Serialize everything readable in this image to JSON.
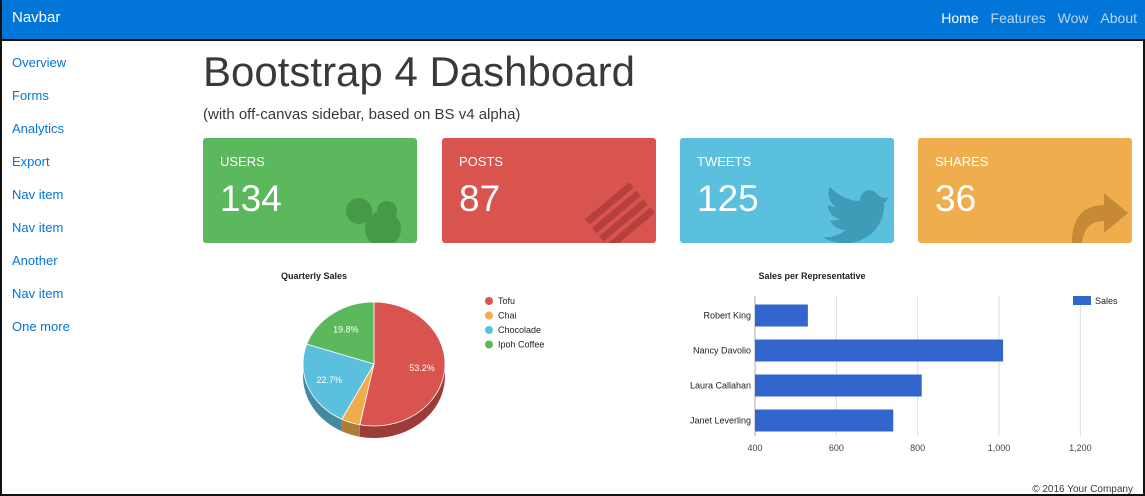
{
  "navbar": {
    "brand": "Navbar",
    "links": [
      "Home",
      "Features",
      "Wow",
      "About"
    ],
    "active": "Home",
    "color": "#0275d8"
  },
  "sidebar": {
    "items": [
      "Overview",
      "Forms",
      "Analytics",
      "Export",
      "Nav item",
      "Nav item",
      "Another",
      "Nav item",
      "One more"
    ]
  },
  "header": {
    "title": "Bootstrap 4 Dashboard",
    "subtitle": "(with off-canvas sidebar, based on BS v4 alpha)"
  },
  "cards": [
    {
      "label": "USERS",
      "value": "134",
      "color": "#5cb85c",
      "icon": "users-icon"
    },
    {
      "label": "POSTS",
      "value": "87",
      "color": "#d9534f",
      "icon": "list-icon"
    },
    {
      "label": "TWEETS",
      "value": "125",
      "color": "#5bc0de",
      "icon": "twitter-icon"
    },
    {
      "label": "SHARES",
      "value": "36",
      "color": "#f0ad4e",
      "icon": "share-icon"
    }
  ],
  "chart_data": [
    {
      "type": "pie",
      "title": "Quarterly Sales",
      "categories": [
        "Tofu",
        "Chai",
        "Chocolade",
        "Ipoh Coffee"
      ],
      "values": [
        53.2,
        4.3,
        22.7,
        19.8
      ],
      "value_labels": [
        "53.2%",
        "",
        "22.7%",
        "19.8%"
      ],
      "colors": [
        "#d9534f",
        "#f0ad4e",
        "#5bc0de",
        "#5cb85c"
      ],
      "legend": "right",
      "style": "3d"
    },
    {
      "type": "bar",
      "orientation": "horizontal",
      "title": "Sales per Representative",
      "categories": [
        "Robert King",
        "Nancy Davolio",
        "Laura Callahan",
        "Janet Leverling"
      ],
      "series": [
        {
          "name": "Sales",
          "values": [
            530,
            1010,
            810,
            740
          ]
        }
      ],
      "xlim": [
        400,
        1300
      ],
      "ticks": [
        "400",
        "600",
        "800",
        "1,000",
        "1,200"
      ],
      "tick_values": [
        400,
        600,
        800,
        1000,
        1200
      ],
      "grid": true,
      "legend": "top-right",
      "color": "#3366cc"
    }
  ],
  "footer": {
    "text": "© 2016 Your Company"
  }
}
